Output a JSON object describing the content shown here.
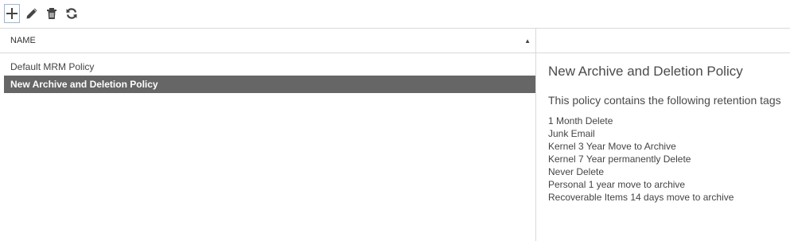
{
  "toolbar": {
    "buttons": [
      {
        "icon": "plus-icon"
      },
      {
        "icon": "pencil-icon"
      },
      {
        "icon": "trash-icon"
      },
      {
        "icon": "refresh-icon"
      }
    ]
  },
  "list": {
    "column_header": "NAME",
    "sort": "ascending",
    "items": [
      {
        "label": "Default MRM Policy",
        "selected": false
      },
      {
        "label": "New Archive and Deletion Policy",
        "selected": true
      }
    ]
  },
  "details": {
    "title": "New Archive and Deletion Policy",
    "subtitle": "This policy contains the following retention tags",
    "tags": [
      "1 Month Delete",
      "Junk Email",
      "Kernel 3 Year Move to Archive",
      "Kernel 7 Year permanently Delete",
      "Never Delete",
      "Personal 1 year move to archive",
      "Recoverable Items 14 days move to archive"
    ]
  },
  "colors": {
    "selected_row": "#666666",
    "icon": "#444444",
    "focus_border": "#9cb7d4",
    "divider": "#d9d9d9"
  }
}
